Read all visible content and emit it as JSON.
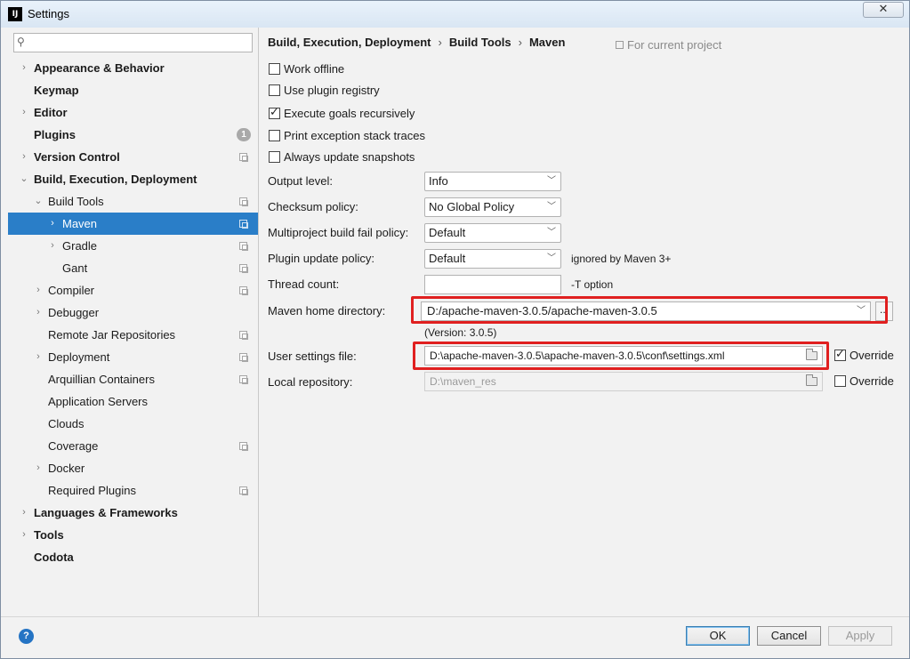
{
  "window": {
    "title": "Settings",
    "app_icon": "IJ",
    "close_glyph": "✕"
  },
  "sidebar": {
    "search_placeholder": "",
    "items": [
      {
        "label": "Appearance & Behavior",
        "bold": true,
        "arrow": "›"
      },
      {
        "label": "Keymap",
        "bold": true
      },
      {
        "label": "Editor",
        "bold": true,
        "arrow": "›"
      },
      {
        "label": "Plugins",
        "bold": true,
        "badge": "1"
      },
      {
        "label": "Version Control",
        "bold": true,
        "arrow": "›"
      },
      {
        "label": "Build, Execution, Deployment",
        "bold": true,
        "arrow": "⌄"
      },
      {
        "label": "Build Tools",
        "arrow": "⌄"
      },
      {
        "label": "Maven",
        "arrow": "›"
      },
      {
        "label": "Gradle",
        "arrow": "›"
      },
      {
        "label": "Gant"
      },
      {
        "label": "Compiler",
        "arrow": "›"
      },
      {
        "label": "Debugger",
        "arrow": "›"
      },
      {
        "label": "Remote Jar Repositories"
      },
      {
        "label": "Deployment",
        "arrow": "›"
      },
      {
        "label": "Arquillian Containers"
      },
      {
        "label": "Application Servers"
      },
      {
        "label": "Clouds"
      },
      {
        "label": "Coverage"
      },
      {
        "label": "Docker",
        "arrow": "›"
      },
      {
        "label": "Required Plugins"
      },
      {
        "label": "Languages & Frameworks",
        "bold": true,
        "arrow": "›"
      },
      {
        "label": "Tools",
        "bold": true,
        "arrow": "›"
      },
      {
        "label": "Codota",
        "bold": true
      }
    ]
  },
  "breadcrumb": {
    "part1": "Build, Execution, Deployment",
    "part2": "Build Tools",
    "part3": "Maven",
    "separator": "›",
    "scope": "For current project"
  },
  "checkboxes": {
    "work_offline": {
      "label": "Work offline",
      "checked": false
    },
    "plugin_registry": {
      "label": "Use plugin registry",
      "checked": false
    },
    "execute_recursive": {
      "label": "Execute goals recursively",
      "checked": true
    },
    "print_stack": {
      "label": "Print exception stack traces",
      "checked": false
    },
    "update_snapshots": {
      "label": "Always update snapshots",
      "checked": false
    }
  },
  "form": {
    "output_level": {
      "label": "Output level:",
      "value": "Info"
    },
    "checksum_policy": {
      "label": "Checksum policy:",
      "value": "No Global Policy"
    },
    "multiproject_policy": {
      "label": "Multiproject build fail policy:",
      "value": "Default"
    },
    "plugin_update_policy": {
      "label": "Plugin update policy:",
      "value": "Default",
      "hint": "ignored by Maven 3+"
    },
    "thread_count": {
      "label": "Thread count:",
      "value": "",
      "hint": "-T option"
    },
    "maven_home": {
      "label": "Maven home directory:",
      "value": "D:/apache-maven-3.0.5/apache-maven-3.0.5",
      "browse_label": "..."
    },
    "version": "(Version: 3.0.5)",
    "user_settings": {
      "label": "User settings file:",
      "value": "D:\\apache-maven-3.0.5\\apache-maven-3.0.5\\conf\\settings.xml",
      "override_label": "Override",
      "override_checked": true
    },
    "local_repo": {
      "label": "Local repository:",
      "value": "D:\\maven_res",
      "override_label": "Override",
      "override_checked": false
    }
  },
  "buttons": {
    "help": "?",
    "ok": "OK",
    "cancel": "Cancel",
    "apply": "Apply"
  },
  "colors": {
    "selection": "#2a7ec8",
    "highlight_box": "#e02020"
  }
}
